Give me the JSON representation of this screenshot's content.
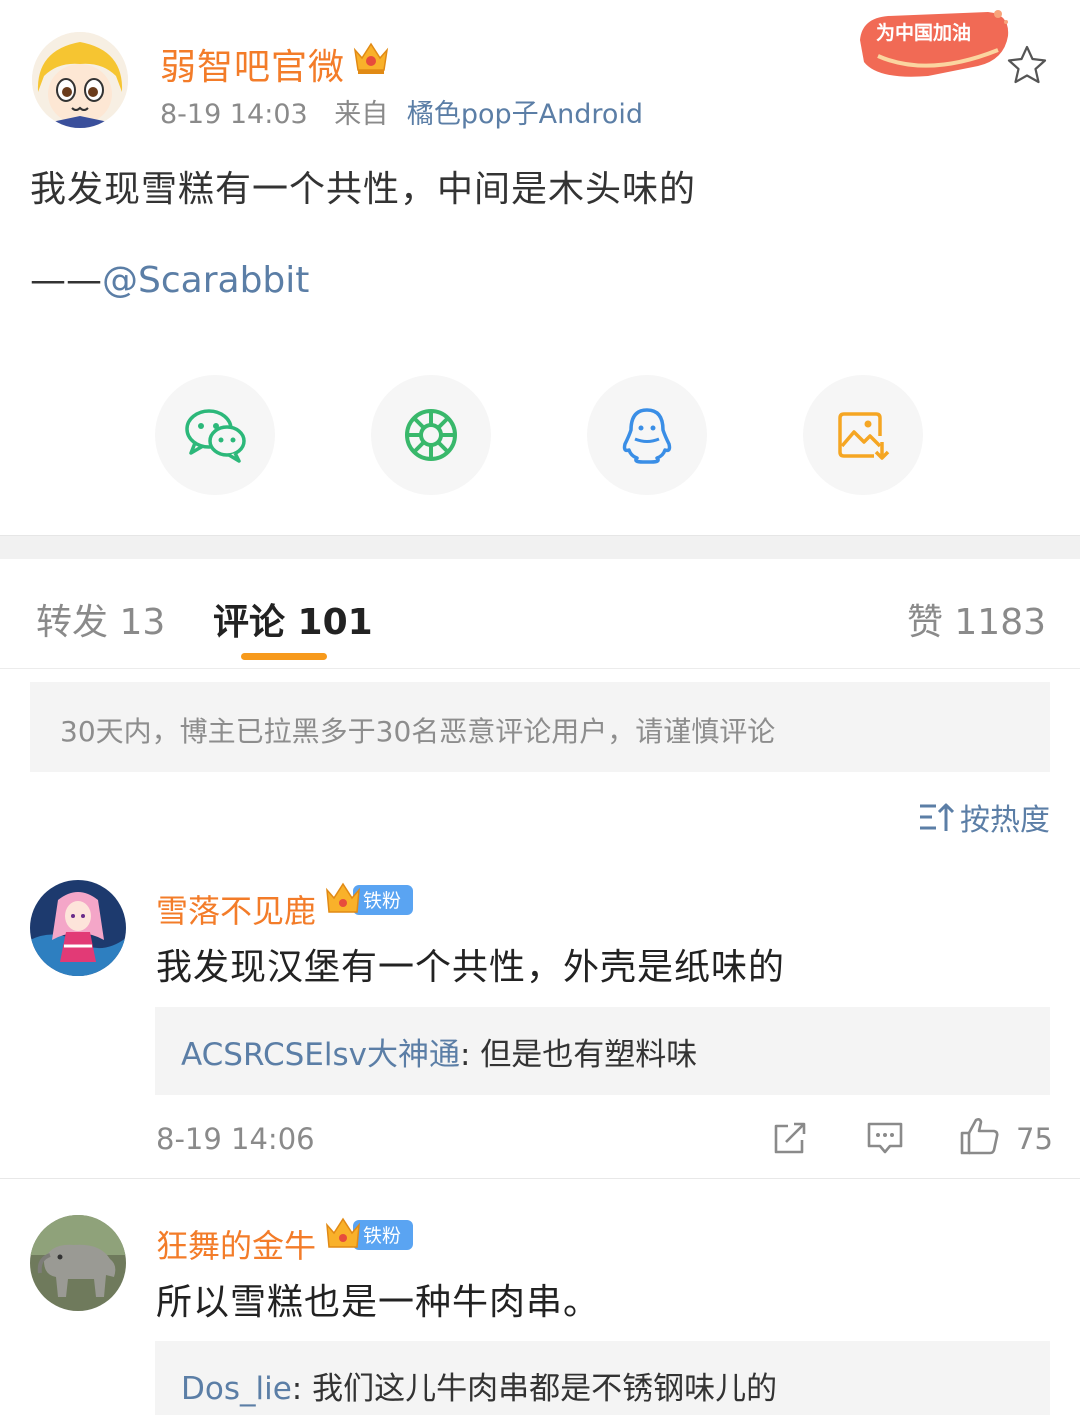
{
  "post": {
    "author": "弱智吧官微",
    "time": "8-19 14:03",
    "from_label": "来自",
    "source": "橘色pop子Android",
    "promo": "为中国加油",
    "text": "我发现雪糕有一个共性，中间是木头味的",
    "credit_dash": "——",
    "credit_mention": "@Scarabbit"
  },
  "share": [
    "wechat-icon",
    "moments-icon",
    "qq-icon",
    "save-image-icon"
  ],
  "tabs": {
    "repost": "转发 13",
    "comment": "评论 101",
    "like": "赞 1183"
  },
  "notice": "30天内，博主已拉黑多于30名恶意评论用户，请谨慎评论",
  "sort_label": "按热度",
  "comments": [
    {
      "name": "雪落不见鹿",
      "badge": "铁粉",
      "text": "我发现汉堡有一个共性，外壳是纸味的",
      "reply_name": "ACSRCSElsv大神通",
      "reply_text": ": 但是也有塑料味",
      "time": "8-19 14:06",
      "likes": "75"
    },
    {
      "name": "狂舞的金牛",
      "badge": "铁粉",
      "text": "所以雪糕也是一种牛肉串。",
      "reply_name": "Dos_lie",
      "reply_text": ": 我们这儿牛肉串都是不锈钢味儿的"
    }
  ],
  "colors": {
    "accent_orange": "#f37c29",
    "link_blue": "#5b7ea6",
    "tab_underline": "#f79a1c"
  }
}
